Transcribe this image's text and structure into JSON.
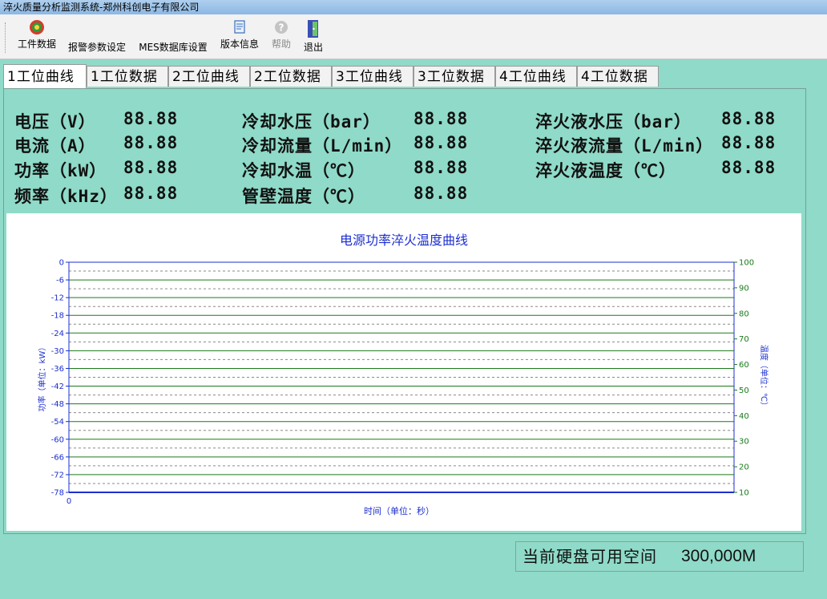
{
  "window": {
    "title": "淬火质量分析监测系统-郑州科创电子有限公司"
  },
  "toolbar": {
    "items": [
      {
        "label": "工件数据",
        "icon": "gear-colorful-icon"
      },
      {
        "label": "报警参数设定",
        "icon": ""
      },
      {
        "label": "MES数据库设置",
        "icon": ""
      },
      {
        "label": "版本信息",
        "icon": "document-icon"
      },
      {
        "label": "帮助",
        "icon": "help-icon",
        "disabled": true
      },
      {
        "label": "退出",
        "icon": "exit-door-icon"
      }
    ]
  },
  "tabs": [
    {
      "label": "1工位曲线",
      "active": true
    },
    {
      "label": "1工位数据"
    },
    {
      "label": "2工位曲线"
    },
    {
      "label": "2工位数据"
    },
    {
      "label": "3工位曲线"
    },
    {
      "label": "3工位数据"
    },
    {
      "label": "4工位曲线"
    },
    {
      "label": "4工位数据"
    }
  ],
  "metrics": {
    "col1": [
      {
        "label": "电压（V）",
        "value": "88.88"
      },
      {
        "label": "电流（A）",
        "value": "88.88"
      },
      {
        "label": "功率（kW）",
        "value": "88.88"
      },
      {
        "label": "频率（kHz）",
        "value": "88.88"
      }
    ],
    "col2": [
      {
        "label": "冷却水压（bar）",
        "value": "88.88"
      },
      {
        "label": "冷却流量（L/min）",
        "value": "88.88"
      },
      {
        "label": "冷却水温（℃）",
        "value": "88.88"
      },
      {
        "label": "管壁温度（℃）",
        "value": "88.88"
      }
    ],
    "col3": [
      {
        "label": "淬火液水压（bar）",
        "value": "88.88"
      },
      {
        "label": "淬火液流量（L/min）",
        "value": "88.88"
      },
      {
        "label": "淬火液温度（℃）",
        "value": "88.88"
      }
    ]
  },
  "chart_data": {
    "type": "line",
    "title": "电源功率淬火温度曲线",
    "xlabel": "时间（单位：秒）",
    "ylabel": "功率（单位：kW）",
    "y2label": "温度（单位：℃）",
    "xticks": [
      "0"
    ],
    "ylim": [
      -78,
      0
    ],
    "yticks": [
      0,
      -6,
      -12,
      -18,
      -24,
      -30,
      -36,
      -42,
      -48,
      -54,
      -60,
      -66,
      -72,
      -78
    ],
    "y2lim": [
      10,
      100
    ],
    "y2ticks": [
      100,
      90,
      80,
      70,
      60,
      50,
      40,
      30,
      20,
      10
    ],
    "series": [],
    "grid": true,
    "colors": {
      "left_axis": "#1c2fd0",
      "right_axis": "#1a7a1a",
      "title": "#1c2fd0"
    }
  },
  "status": {
    "label": "当前硬盘可用空间",
    "value": "300,000M"
  }
}
